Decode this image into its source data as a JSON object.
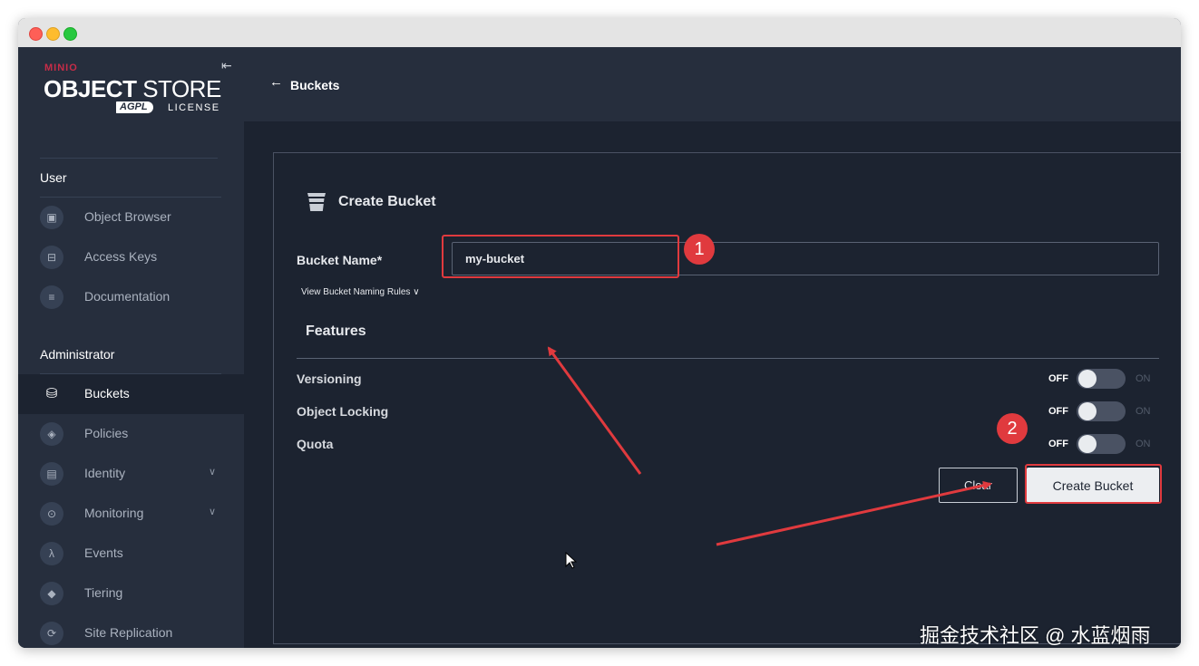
{
  "sidebar": {
    "brand": {
      "minio": "MINIO",
      "title_bold": "OBJECT",
      "title_light": " STORE",
      "agpl": "AGPL",
      "license": "LICENSE"
    },
    "user_section": "User",
    "user_items": [
      {
        "label": "Object Browser",
        "icon": "object-browser-icon"
      },
      {
        "label": "Access Keys",
        "icon": "access-keys-icon"
      },
      {
        "label": "Documentation",
        "icon": "documentation-icon"
      }
    ],
    "admin_section": "Administrator",
    "admin_items": [
      {
        "label": "Buckets",
        "icon": "bucket-icon",
        "active": true
      },
      {
        "label": "Policies",
        "icon": "shield-icon"
      },
      {
        "label": "Identity",
        "icon": "id-card-icon",
        "expandable": true
      },
      {
        "label": "Monitoring",
        "icon": "magnifier-icon",
        "expandable": true
      },
      {
        "label": "Events",
        "icon": "lambda-icon"
      },
      {
        "label": "Tiering",
        "icon": "layers-icon"
      },
      {
        "label": "Site Replication",
        "icon": "replication-icon"
      }
    ]
  },
  "header": {
    "breadcrumb": "Buckets"
  },
  "form": {
    "title": "Create Bucket",
    "bucket_name_label": "Bucket Name*",
    "bucket_name_value": "my-bucket",
    "naming_rules_link": "View Bucket Naming Rules",
    "features_title": "Features",
    "features": [
      {
        "label": "Versioning",
        "off": "OFF",
        "on": "ON",
        "enabled": false
      },
      {
        "label": "Object Locking",
        "off": "OFF",
        "on": "ON",
        "enabled": false
      },
      {
        "label": "Quota",
        "off": "OFF",
        "on": "ON",
        "enabled": false
      }
    ],
    "clear_label": "Clear",
    "create_label": "Create Bucket"
  },
  "annotations": {
    "badge_1": "1",
    "badge_2": "2",
    "color": "#e03a3e"
  },
  "watermark": "掘金技术社区 @ 水蓝烟雨",
  "colors": {
    "sidebar_bg": "#262e3d",
    "content_bg": "#1c2330",
    "minio_red": "#c72c48"
  }
}
